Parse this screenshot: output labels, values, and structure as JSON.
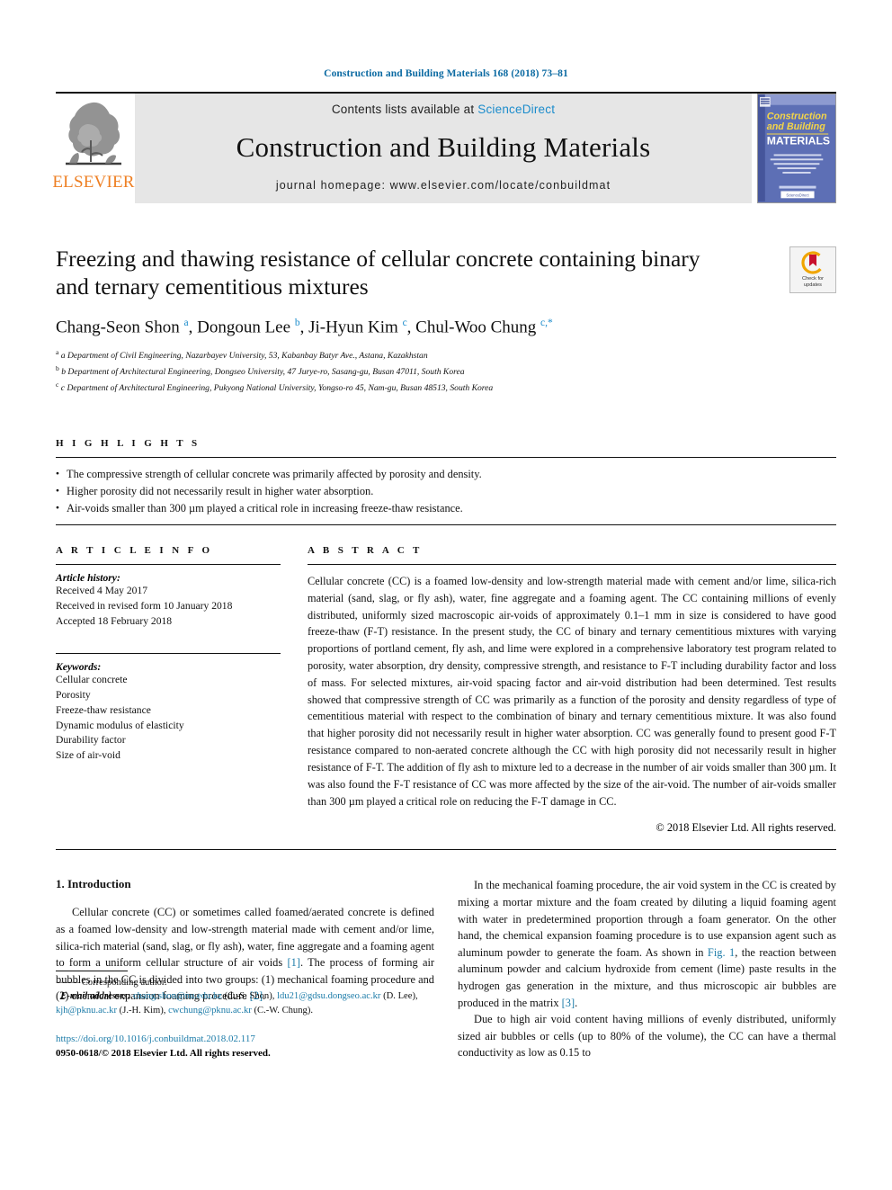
{
  "running_head": "Construction and Building Materials 168 (2018) 73–81",
  "masthead": {
    "publisher_name": "ELSEVIER",
    "contents_prefix": "Contents lists available at",
    "contents_link": "ScienceDirect",
    "journal_title": "Construction and Building Materials",
    "homepage": "journal homepage: www.elsevier.com/locate/conbuildmat",
    "cover": {
      "line1": "Construction",
      "line2": "and Building",
      "line3": "MATERIALS",
      "blurb": "An International Journal dedicated to the Investigation and Innovative Use of Materials in Construction and Repair",
      "footer_badge": "ScienceDirect"
    }
  },
  "article": {
    "title": "Freezing and thawing resistance of cellular concrete containing binary and ternary cementitious mixtures",
    "authors_html": "Chang-Seon Shon <sup>a</sup>, Dongoun Lee <sup>b</sup>, Ji-Hyun Kim <sup>c</sup>, Chul-Woo Chung <sup>c,</sup><sup>*</sup>",
    "affiliations": [
      "a Department of Civil Engineering, Nazarbayev University, 53, Kabanbay Batyr Ave., Astana, Kazakhstan",
      "b Department of Architectural Engineering, Dongseo University, 47 Jurye-ro, Sasang-gu, Busan 47011, South Korea",
      "c Department of Architectural Engineering, Pukyong National University, Yongso-ro 45, Nam-gu, Busan 48513, South Korea"
    ],
    "crossmark": {
      "line1": "Check for",
      "line2": "updates"
    }
  },
  "highlights": {
    "heading": "H I G H L I G H T S",
    "items": [
      "The compressive strength of cellular concrete was primarily affected by porosity and density.",
      "Higher porosity did not necessarily result in higher water absorption.",
      "Air-voids smaller than 300 µm played a critical role in increasing freeze-thaw resistance."
    ]
  },
  "article_info": {
    "heading": "A R T I C L E    I N F O",
    "history_label": "Article history:",
    "history": [
      "Received 4 May 2017",
      "Received in revised form 10 January 2018",
      "Accepted 18 February 2018"
    ],
    "keywords_label": "Keywords:",
    "keywords": [
      "Cellular concrete",
      "Porosity",
      "Freeze-thaw resistance",
      "Dynamic modulus of elasticity",
      "Durability factor",
      "Size of air-void"
    ]
  },
  "abstract": {
    "heading": "A B S T R A C T",
    "text": "Cellular concrete (CC) is a foamed low-density and low-strength material made with cement and/or lime, silica-rich material (sand, slag, or fly ash), water, fine aggregate and a foaming agent. The CC containing millions of evenly distributed, uniformly sized macroscopic air-voids of approximately 0.1–1 mm in size is considered to have good freeze-thaw (F-T) resistance. In the present study, the CC of binary and ternary cementitious mixtures with varying proportions of portland cement, fly ash, and lime were explored in a comprehensive laboratory test program related to porosity, water absorption, dry density, compressive strength, and resistance to F-T including durability factor and loss of mass. For selected mixtures, air-void spacing factor and air-void distribution had been determined. Test results showed that compressive strength of CC was primarily as a function of the porosity and density regardless of type of cementitious material with respect to the combination of binary and ternary cementitious mixture. It was also found that higher porosity did not necessarily result in higher water absorption. CC was generally found to present good F-T resistance compared to non-aerated concrete although the CC with high porosity did not necessarily result in higher resistance of F-T. The addition of fly ash to mixture led to a decrease in the number of air voids smaller than 300 µm. It was also found the F-T resistance of CC was more affected by the size of the air-void. The number of air-voids smaller than 300 µm played a critical role on reducing the F-T damage in CC.",
    "copyright": "© 2018 Elsevier Ltd. All rights reserved."
  },
  "introduction": {
    "heading": "1. Introduction",
    "left_paragraph_1_html": "Cellular concrete (CC) or sometimes called foamed/aerated concrete is defined as a foamed low-density and low-strength material made with cement and/or lime, silica-rich material (sand, slag, or fly ash), water, fine aggregate and a foaming agent to form a uniform cellular structure of air voids <span class=\"ref\">[1]</span>. The process of forming air bubbles in the CC is divided into two groups: (1) mechanical foaming procedure and (2) chemical expansion foaming procedure <span class=\"ref\">[2]</span>.",
    "right_paragraph_1_html": "In the mechanical foaming procedure, the air void system in the CC is created by mixing a mortar mixture and the foam created by diluting a liquid foaming agent with water in predetermined proportion through a foam generator. On the other hand, the chemical expansion foaming procedure is to use expansion agent such as aluminum powder to generate the foam. As shown in <span class=\"ref\">Fig. 1</span>, the reaction between aluminum powder and calcium hydroxide from cement (lime) paste results in the hydrogen gas generation in the mixture, and thus microscopic air bubbles are produced in the matrix <span class=\"ref\">[3]</span>.",
    "right_paragraph_2_html": "Due to high air void content having millions of evenly distributed, uniformly sized air bubbles or cells (up to 80% of the volume), the CC can have a thermal conductivity as low as 0.15 to"
  },
  "footnote": {
    "corresponding_marker": "⸻",
    "corresponding_text": "Corresponding author.",
    "email_label": "E-mail addresses:",
    "emails_html": "<span class=\"fn-link\">chang.shon@nu.edu.kz</span> (C.-S. Shon), <span class=\"fn-link\">ldu21@gdsu.dongseo.ac.kr</span> (D. Lee), <span class=\"fn-link\">kjh@pknu.ac.kr</span> (J.-H. Kim), <span class=\"fn-link\">cwchung@pknu.ac.kr</span> (C.-W. Chung).",
    "doi": "https://doi.org/10.1016/j.conbuildmat.2018.02.117",
    "issn_line": "0950-0618/© 2018 Elsevier Ltd. All rights reserved."
  },
  "colors": {
    "link_blue": "#1b7ba8",
    "header_blue": "#0b6aa2",
    "sciencedirect_blue": "#1b8ccc",
    "elsevier_orange": "#ee7f23",
    "masthead_gray": "#e6e6e6",
    "cover_blue": "#5d6fb5"
  }
}
